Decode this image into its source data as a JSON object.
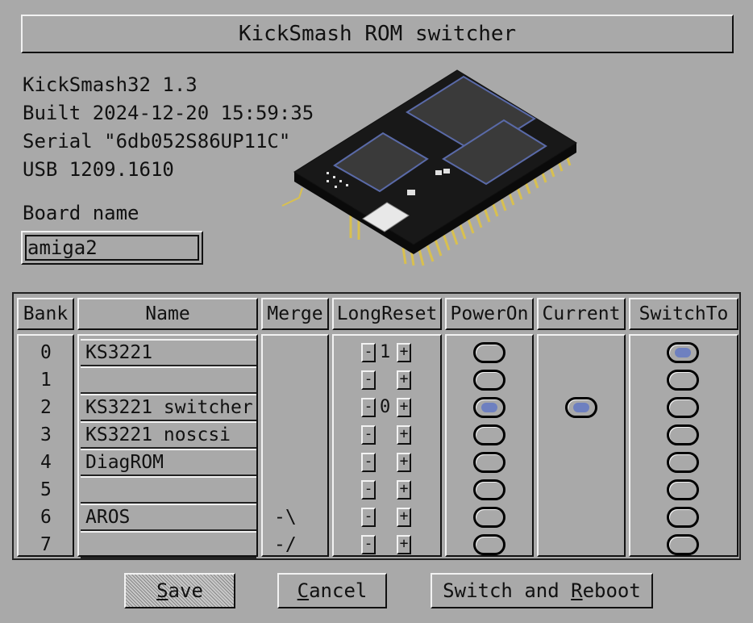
{
  "window": {
    "title": "KickSmash ROM switcher"
  },
  "info": {
    "line1": "KickSmash32 1.3",
    "line2": "Built 2024-12-20 15:59:35",
    "line3": "Serial \"6db052S86UP11C\"",
    "line4": "USB 1209.1610"
  },
  "board": {
    "label": "Board name",
    "value": "amiga2"
  },
  "table": {
    "headers": {
      "bank": "Bank",
      "name": "Name",
      "merge": "Merge",
      "longreset": "LongReset",
      "poweron": "PowerOn",
      "current": "Current",
      "switchto": "SwitchTo"
    },
    "rows": [
      {
        "bank": "0",
        "name": "KS3221",
        "merge": "",
        "longreset": "1",
        "poweron": false,
        "current": false,
        "switchto": true
      },
      {
        "bank": "1",
        "name": "",
        "merge": "",
        "longreset": "",
        "poweron": false,
        "current": false,
        "switchto": false
      },
      {
        "bank": "2",
        "name": "KS3221 switcher",
        "merge": "",
        "longreset": "0",
        "poweron": true,
        "current": true,
        "switchto": false
      },
      {
        "bank": "3",
        "name": "KS3221 noscsi",
        "merge": "",
        "longreset": "",
        "poweron": false,
        "current": false,
        "switchto": false
      },
      {
        "bank": "4",
        "name": "DiagROM",
        "merge": "",
        "longreset": "",
        "poweron": false,
        "current": false,
        "switchto": false
      },
      {
        "bank": "5",
        "name": "",
        "merge": "",
        "longreset": "",
        "poweron": false,
        "current": false,
        "switchto": false
      },
      {
        "bank": "6",
        "name": "AROS",
        "merge": "-\\",
        "longreset": "",
        "poweron": false,
        "current": false,
        "switchto": false
      },
      {
        "bank": "7",
        "name": "",
        "merge": "-/",
        "longreset": "",
        "poweron": false,
        "current": false,
        "switchto": false
      }
    ],
    "minus_label": "-",
    "plus_label": "+"
  },
  "buttons": {
    "save": {
      "key": "S",
      "rest": "ave"
    },
    "cancel": {
      "key": "C",
      "rest": "ancel"
    },
    "reboot": {
      "pre": "Switch and ",
      "key": "R",
      "rest": "eboot"
    }
  },
  "colors": {
    "background": "#a9a9a9",
    "highlight": "#f2f2f2",
    "shadow": "#111111",
    "selected": "#6e80c0",
    "pin_gold": "#d8c050"
  }
}
